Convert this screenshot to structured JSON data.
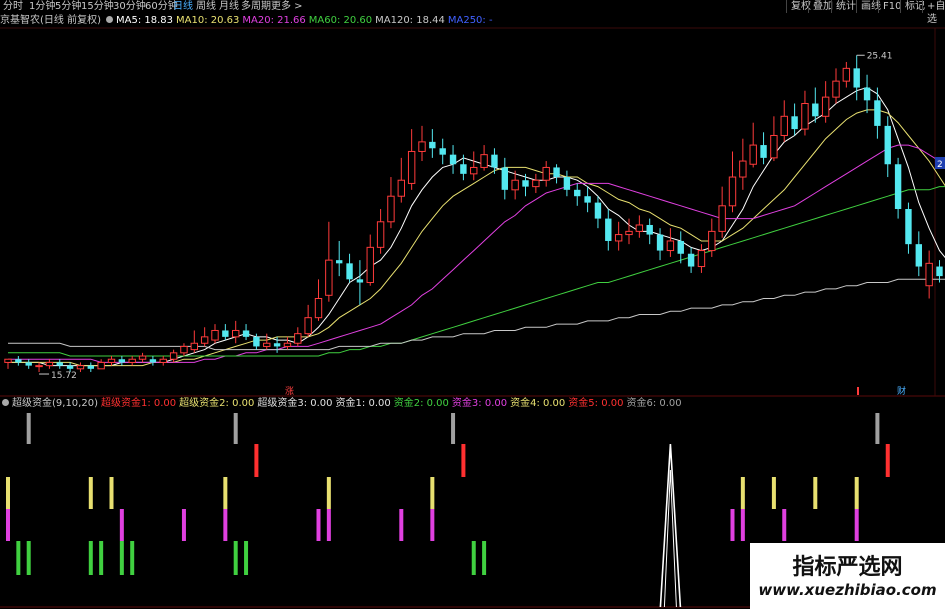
{
  "toolbar": {
    "tabs": [
      "分时",
      "1分钟",
      "5分钟",
      "15分钟",
      "30分钟",
      "60分钟",
      "日线",
      "周线",
      "月线",
      "多周期",
      "更多"
    ],
    "active_tab": "日线",
    "right_buttons": [
      "复权",
      "叠加",
      "统计",
      "画线",
      "F10",
      "标记",
      "+自选"
    ]
  },
  "legend": {
    "title": "京基智农(日线 前复权)",
    "ma": [
      {
        "label": "MA5: 18.83",
        "color": "#ffffff"
      },
      {
        "label": "MA10: 20.63",
        "color": "#e8e070"
      },
      {
        "label": "MA20: 21.66",
        "color": "#e040e0"
      },
      {
        "label": "MA60: 20.60",
        "color": "#40d040"
      },
      {
        "label": "MA120: 18.44",
        "color": "#c8c8c8"
      },
      {
        "label": "MA250: -",
        "color": "#4060ff"
      }
    ]
  },
  "indicator_legend": {
    "title": "超级资金(9,10,20)",
    "items": [
      {
        "label": "超级资金1: 0.00",
        "color": "#ff3030"
      },
      {
        "label": "超级资金2: 0.00",
        "color": "#e8e070"
      },
      {
        "label": "超级资金3: 0.00",
        "color": "#e0e0e0"
      },
      {
        "label": "资金1: 0.00",
        "color": "#e0e0e0"
      },
      {
        "label": "资金2: 0.00",
        "color": "#40d040"
      },
      {
        "label": "资金3: 0.00",
        "color": "#e040e0"
      },
      {
        "label": "资金4: 0.00",
        "color": "#e8e070"
      },
      {
        "label": "资金5: 0.00",
        "color": "#ff3030"
      },
      {
        "label": "资金6: 0.00",
        "color": "#a0a0a0"
      }
    ]
  },
  "chart_data": {
    "type": "candlestick",
    "price_range": [
      15.0,
      26.2
    ],
    "high_label": "25.41",
    "low_label": "15.72",
    "axis_right_label": "2",
    "markers": [
      {
        "text": "涨",
        "color": "#ff4040"
      },
      {
        "text": "财",
        "color": "#4ab0ff"
      }
    ],
    "candles": [
      [
        15.8,
        15.9,
        15.6,
        15.9
      ],
      [
        15.9,
        15.8,
        15.7,
        16.0
      ],
      [
        15.8,
        15.7,
        15.6,
        15.9
      ],
      [
        15.7,
        15.7,
        15.5,
        15.8
      ],
      [
        15.7,
        15.8,
        15.6,
        15.9
      ],
      [
        15.8,
        15.7,
        15.6,
        15.9
      ],
      [
        15.7,
        15.6,
        15.5,
        15.8
      ],
      [
        15.6,
        15.7,
        15.5,
        15.8
      ],
      [
        15.7,
        15.6,
        15.5,
        15.8
      ],
      [
        15.6,
        15.8,
        15.6,
        15.9
      ],
      [
        15.8,
        15.9,
        15.7,
        16.0
      ],
      [
        15.9,
        15.8,
        15.7,
        16.0
      ],
      [
        15.8,
        15.9,
        15.7,
        16.0
      ],
      [
        15.9,
        16.0,
        15.8,
        16.1
      ],
      [
        15.9,
        15.8,
        15.7,
        16.0
      ],
      [
        15.8,
        15.9,
        15.7,
        16.0
      ],
      [
        15.9,
        16.1,
        15.8,
        16.2
      ],
      [
        16.1,
        16.3,
        16.0,
        16.4
      ],
      [
        16.2,
        16.4,
        16.1,
        16.8
      ],
      [
        16.4,
        16.6,
        16.3,
        16.9
      ],
      [
        16.5,
        16.8,
        16.4,
        17.0
      ],
      [
        16.8,
        16.6,
        16.5,
        17.0
      ],
      [
        16.6,
        16.8,
        16.4,
        17.1
      ],
      [
        16.8,
        16.6,
        16.5,
        17.0
      ],
      [
        16.6,
        16.3,
        16.2,
        16.7
      ],
      [
        16.3,
        16.4,
        16.2,
        16.7
      ],
      [
        16.4,
        16.3,
        16.1,
        16.6
      ],
      [
        16.3,
        16.4,
        16.2,
        16.6
      ],
      [
        16.4,
        16.7,
        16.3,
        16.9
      ],
      [
        16.7,
        17.2,
        16.6,
        17.6
      ],
      [
        17.2,
        17.8,
        17.1,
        18.4
      ],
      [
        17.9,
        19.0,
        17.7,
        20.2
      ],
      [
        19.0,
        18.9,
        18.5,
        19.6
      ],
      [
        18.9,
        18.4,
        18.3,
        19.2
      ],
      [
        18.4,
        18.3,
        17.6,
        19.0
      ],
      [
        18.3,
        19.4,
        18.2,
        19.8
      ],
      [
        19.4,
        20.2,
        19.2,
        20.6
      ],
      [
        20.2,
        21.0,
        20.0,
        21.6
      ],
      [
        21.0,
        21.5,
        20.8,
        22.2
      ],
      [
        21.4,
        22.4,
        21.2,
        23.1
      ],
      [
        22.4,
        22.7,
        22.1,
        23.2
      ],
      [
        22.7,
        22.5,
        22.2,
        23.1
      ],
      [
        22.5,
        22.3,
        22.0,
        22.8
      ],
      [
        22.3,
        22.0,
        21.7,
        22.6
      ],
      [
        22.0,
        21.7,
        21.5,
        22.3
      ],
      [
        21.7,
        21.9,
        21.5,
        22.4
      ],
      [
        21.9,
        22.3,
        21.8,
        22.6
      ],
      [
        22.3,
        21.9,
        21.7,
        22.5
      ],
      [
        21.9,
        21.2,
        20.9,
        22.2
      ],
      [
        21.2,
        21.5,
        20.9,
        21.8
      ],
      [
        21.5,
        21.3,
        21.0,
        21.7
      ],
      [
        21.3,
        21.5,
        21.1,
        21.7
      ],
      [
        21.5,
        21.9,
        21.3,
        22.1
      ],
      [
        21.9,
        21.6,
        21.4,
        22.0
      ],
      [
        21.6,
        21.2,
        21.0,
        21.8
      ],
      [
        21.2,
        21.0,
        20.7,
        21.4
      ],
      [
        21.0,
        20.8,
        20.5,
        21.3
      ],
      [
        20.8,
        20.3,
        20.0,
        21.0
      ],
      [
        20.3,
        19.6,
        19.3,
        20.6
      ],
      [
        19.6,
        19.8,
        19.3,
        20.2
      ],
      [
        19.8,
        19.9,
        19.5,
        20.3
      ],
      [
        19.9,
        20.1,
        19.7,
        20.4
      ],
      [
        20.1,
        19.8,
        19.5,
        20.3
      ],
      [
        19.8,
        19.3,
        19.0,
        20.0
      ],
      [
        19.3,
        19.6,
        19.1,
        20.0
      ],
      [
        19.6,
        19.2,
        18.9,
        19.9
      ],
      [
        19.2,
        18.8,
        18.6,
        19.4
      ],
      [
        18.8,
        19.3,
        18.6,
        19.5
      ],
      [
        19.3,
        19.9,
        19.1,
        20.3
      ],
      [
        19.9,
        20.7,
        19.7,
        21.3
      ],
      [
        20.7,
        21.6,
        20.5,
        22.4
      ],
      [
        21.6,
        22.1,
        21.2,
        22.8
      ],
      [
        22.0,
        22.6,
        21.9,
        23.3
      ],
      [
        22.6,
        22.2,
        22.0,
        23.0
      ],
      [
        22.2,
        22.9,
        22.1,
        23.5
      ],
      [
        22.9,
        23.5,
        22.7,
        24.0
      ],
      [
        23.5,
        23.1,
        22.9,
        23.9
      ],
      [
        23.1,
        23.9,
        22.9,
        24.3
      ],
      [
        23.9,
        23.5,
        23.3,
        24.4
      ],
      [
        23.5,
        24.1,
        23.3,
        24.6
      ],
      [
        24.1,
        24.6,
        23.9,
        25.0
      ],
      [
        24.6,
        25.0,
        24.4,
        25.2
      ],
      [
        25.0,
        24.4,
        24.0,
        25.41
      ],
      [
        24.4,
        24.0,
        23.6,
        24.8
      ],
      [
        24.0,
        23.2,
        22.8,
        24.4
      ],
      [
        23.2,
        22.0,
        21.6,
        23.5
      ],
      [
        22.0,
        20.6,
        20.3,
        22.2
      ],
      [
        20.6,
        19.5,
        19.2,
        20.8
      ],
      [
        19.5,
        18.8,
        18.5,
        19.9
      ],
      [
        18.2,
        18.9,
        17.8,
        19.3
      ],
      [
        18.8,
        18.5,
        18.3,
        19.0
      ],
      [
        18.5,
        19.0,
        18.3,
        19.6
      ]
    ],
    "ma_lines": [
      {
        "name": "MA5",
        "color": "#ffffff",
        "values": [
          15.8,
          15.8,
          15.8,
          15.8,
          15.7,
          15.7,
          15.7,
          15.7,
          15.7,
          15.7,
          15.7,
          15.8,
          15.8,
          15.8,
          15.8,
          15.8,
          15.9,
          16.0,
          16.1,
          16.2,
          16.4,
          16.5,
          16.6,
          16.7,
          16.6,
          16.6,
          16.5,
          16.5,
          16.4,
          16.6,
          16.9,
          17.3,
          17.8,
          18.3,
          18.5,
          18.8,
          19.0,
          19.4,
          20.0,
          20.7,
          21.2,
          21.6,
          21.9,
          22.0,
          22.2,
          22.1,
          22.0,
          21.9,
          21.8,
          21.7,
          21.6,
          21.5,
          21.5,
          21.6,
          21.6,
          21.5,
          21.3,
          21.0,
          20.6,
          20.4,
          20.1,
          19.9,
          19.9,
          19.8,
          19.7,
          19.6,
          19.4,
          19.3,
          19.4,
          19.6,
          20.1,
          20.6,
          21.3,
          21.8,
          22.3,
          22.7,
          22.9,
          23.2,
          23.4,
          23.6,
          23.9,
          24.1,
          24.3,
          24.4,
          24.2,
          23.7,
          22.8,
          21.9,
          20.8,
          20.0,
          19.3,
          18.9
        ]
      },
      {
        "name": "MA10",
        "color": "#e8e070",
        "values": [
          15.8,
          15.8,
          15.8,
          15.8,
          15.8,
          15.8,
          15.8,
          15.7,
          15.7,
          15.7,
          15.7,
          15.7,
          15.7,
          15.7,
          15.8,
          15.8,
          15.8,
          15.9,
          15.9,
          16.0,
          16.1,
          16.2,
          16.3,
          16.4,
          16.5,
          16.5,
          16.6,
          16.6,
          16.6,
          16.6,
          16.7,
          16.9,
          17.2,
          17.4,
          17.6,
          17.8,
          18.1,
          18.5,
          18.9,
          19.4,
          19.9,
          20.3,
          20.7,
          21.0,
          21.2,
          21.4,
          21.6,
          21.8,
          21.9,
          21.9,
          21.9,
          21.8,
          21.7,
          21.7,
          21.6,
          21.6,
          21.4,
          21.3,
          21.1,
          20.9,
          20.8,
          20.6,
          20.5,
          20.3,
          20.1,
          20.0,
          19.8,
          19.6,
          19.6,
          19.6,
          19.8,
          20.0,
          20.3,
          20.6,
          20.9,
          21.2,
          21.6,
          22.0,
          22.4,
          22.8,
          23.1,
          23.4,
          23.6,
          23.7,
          23.7,
          23.6,
          23.3,
          22.9,
          22.5,
          22.1,
          21.6,
          21.1
        ]
      },
      {
        "name": "MA20",
        "color": "#e040e0",
        "values": [
          15.9,
          15.9,
          15.9,
          15.9,
          15.9,
          15.9,
          15.9,
          15.9,
          15.9,
          15.8,
          15.8,
          15.8,
          15.8,
          15.8,
          15.8,
          15.8,
          15.8,
          15.8,
          15.8,
          15.9,
          15.9,
          16.0,
          16.0,
          16.1,
          16.1,
          16.2,
          16.2,
          16.3,
          16.3,
          16.3,
          16.4,
          16.5,
          16.6,
          16.7,
          16.8,
          16.9,
          17.0,
          17.2,
          17.4,
          17.6,
          17.9,
          18.1,
          18.4,
          18.7,
          19.0,
          19.3,
          19.6,
          19.9,
          20.2,
          20.4,
          20.7,
          20.9,
          21.1,
          21.2,
          21.3,
          21.4,
          21.4,
          21.4,
          21.4,
          21.3,
          21.2,
          21.1,
          21.0,
          20.9,
          20.8,
          20.7,
          20.6,
          20.5,
          20.4,
          20.3,
          20.3,
          20.3,
          20.3,
          20.4,
          20.5,
          20.6,
          20.7,
          20.9,
          21.1,
          21.3,
          21.5,
          21.7,
          21.9,
          22.1,
          22.3,
          22.5,
          22.6,
          22.6,
          22.5,
          22.3,
          22.1,
          21.8
        ]
      },
      {
        "name": "MA60",
        "color": "#40d040",
        "values": [
          16.1,
          16.1,
          16.1,
          16.1,
          16.1,
          16.1,
          16.0,
          16.0,
          16.0,
          16.0,
          16.0,
          16.0,
          16.0,
          16.0,
          16.0,
          16.0,
          16.0,
          16.0,
          16.0,
          16.0,
          16.0,
          16.0,
          16.0,
          16.0,
          16.0,
          16.0,
          16.0,
          16.0,
          16.0,
          16.0,
          16.0,
          16.1,
          16.1,
          16.2,
          16.2,
          16.3,
          16.3,
          16.4,
          16.4,
          16.5,
          16.6,
          16.7,
          16.8,
          16.9,
          17.0,
          17.1,
          17.2,
          17.3,
          17.4,
          17.5,
          17.6,
          17.7,
          17.8,
          17.9,
          18.0,
          18.1,
          18.2,
          18.3,
          18.3,
          18.4,
          18.5,
          18.6,
          18.7,
          18.8,
          18.9,
          19.0,
          19.1,
          19.2,
          19.3,
          19.4,
          19.5,
          19.6,
          19.7,
          19.8,
          19.9,
          20.0,
          20.1,
          20.2,
          20.3,
          20.4,
          20.5,
          20.6,
          20.7,
          20.8,
          20.9,
          21.0,
          21.1,
          21.2,
          21.2,
          21.2,
          21.3,
          21.3
        ]
      },
      {
        "name": "MA120",
        "color": "#c8c8c8",
        "values": [
          16.4,
          16.4,
          16.4,
          16.4,
          16.4,
          16.4,
          16.3,
          16.3,
          16.3,
          16.3,
          16.3,
          16.3,
          16.3,
          16.3,
          16.3,
          16.3,
          16.3,
          16.3,
          16.3,
          16.3,
          16.2,
          16.2,
          16.2,
          16.2,
          16.2,
          16.2,
          16.2,
          16.2,
          16.2,
          16.2,
          16.2,
          16.2,
          16.3,
          16.3,
          16.3,
          16.3,
          16.4,
          16.4,
          16.4,
          16.5,
          16.5,
          16.6,
          16.6,
          16.6,
          16.7,
          16.7,
          16.7,
          16.8,
          16.8,
          16.8,
          16.9,
          16.9,
          16.9,
          17.0,
          17.0,
          17.0,
          17.1,
          17.1,
          17.1,
          17.2,
          17.2,
          17.3,
          17.3,
          17.3,
          17.4,
          17.4,
          17.5,
          17.5,
          17.5,
          17.6,
          17.6,
          17.7,
          17.7,
          17.8,
          17.8,
          17.9,
          17.9,
          18.0,
          18.0,
          18.1,
          18.1,
          18.2,
          18.2,
          18.3,
          18.3,
          18.3,
          18.4,
          18.4,
          18.4,
          18.4,
          18.4,
          18.4
        ]
      }
    ],
    "indicator": {
      "rows": [
        {
          "name": "资金6",
          "color": "#a0a0a0",
          "bars": [
            2,
            22,
            43,
            84
          ]
        },
        {
          "name": "资金5",
          "color": "#ff3030",
          "bars": [
            24,
            44,
            85
          ]
        },
        {
          "name": "资金4",
          "color": "#e8e070",
          "bars": [
            0,
            8,
            10,
            21,
            31,
            41,
            71,
            74,
            78,
            82
          ]
        },
        {
          "name": "资金3",
          "color": "#e040e0",
          "bars": [
            0,
            11,
            17,
            21,
            30,
            31,
            38,
            41,
            70,
            71,
            75,
            82
          ]
        },
        {
          "name": "资金2",
          "color": "#40d040",
          "bars": [
            1,
            2,
            8,
            9,
            11,
            12,
            22,
            23,
            45,
            46
          ]
        }
      ],
      "spike_index": 64
    }
  },
  "watermark": {
    "cn": "指标严选网",
    "en": "www.xuezhibiao.com"
  }
}
